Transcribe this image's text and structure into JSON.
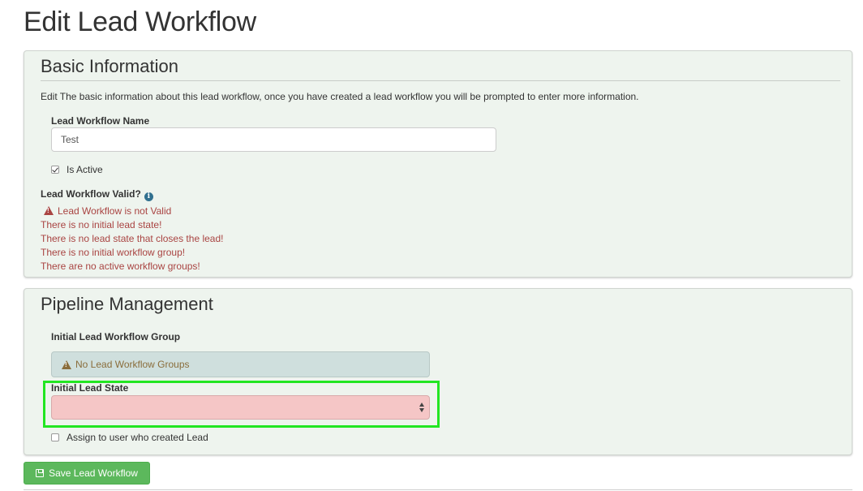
{
  "page": {
    "title": "Edit Lead Workflow"
  },
  "basic_info": {
    "title": "Basic Information",
    "description": "Edit The basic information about this lead workflow, once you have created a lead workflow you will be prompted to enter more information.",
    "name_label": "Lead Workflow Name",
    "name_value": "Test",
    "is_active_label": "Is Active",
    "is_active_checked": true,
    "valid_label": "Lead Workflow Valid?",
    "valid_status": "Lead Workflow is not Valid",
    "errors": [
      "There is no initial lead state!",
      "There is no lead state that closes the lead!",
      "There is no initial workflow group!",
      "There are no active workflow groups!"
    ]
  },
  "pipeline": {
    "title": "Pipeline Management",
    "group_label": "Initial Lead Workflow Group",
    "group_alert": "No Lead Workflow Groups",
    "state_label": "Initial Lead State",
    "state_value": "",
    "assign_label": "Assign to user who created Lead",
    "assign_checked": false
  },
  "actions": {
    "save_label": "Save Lead Workflow"
  },
  "colors": {
    "panel_bg": "#eef4ee",
    "error_text": "#a94442",
    "warning_text": "#8a6d3b",
    "select_error_bg": "#f5c6c6",
    "highlight_border": "#22e622",
    "save_button": "#5cb85c"
  },
  "icons": {
    "info": "info-circle-icon",
    "warning": "warning-triangle-icon",
    "save": "floppy-disk-icon"
  }
}
